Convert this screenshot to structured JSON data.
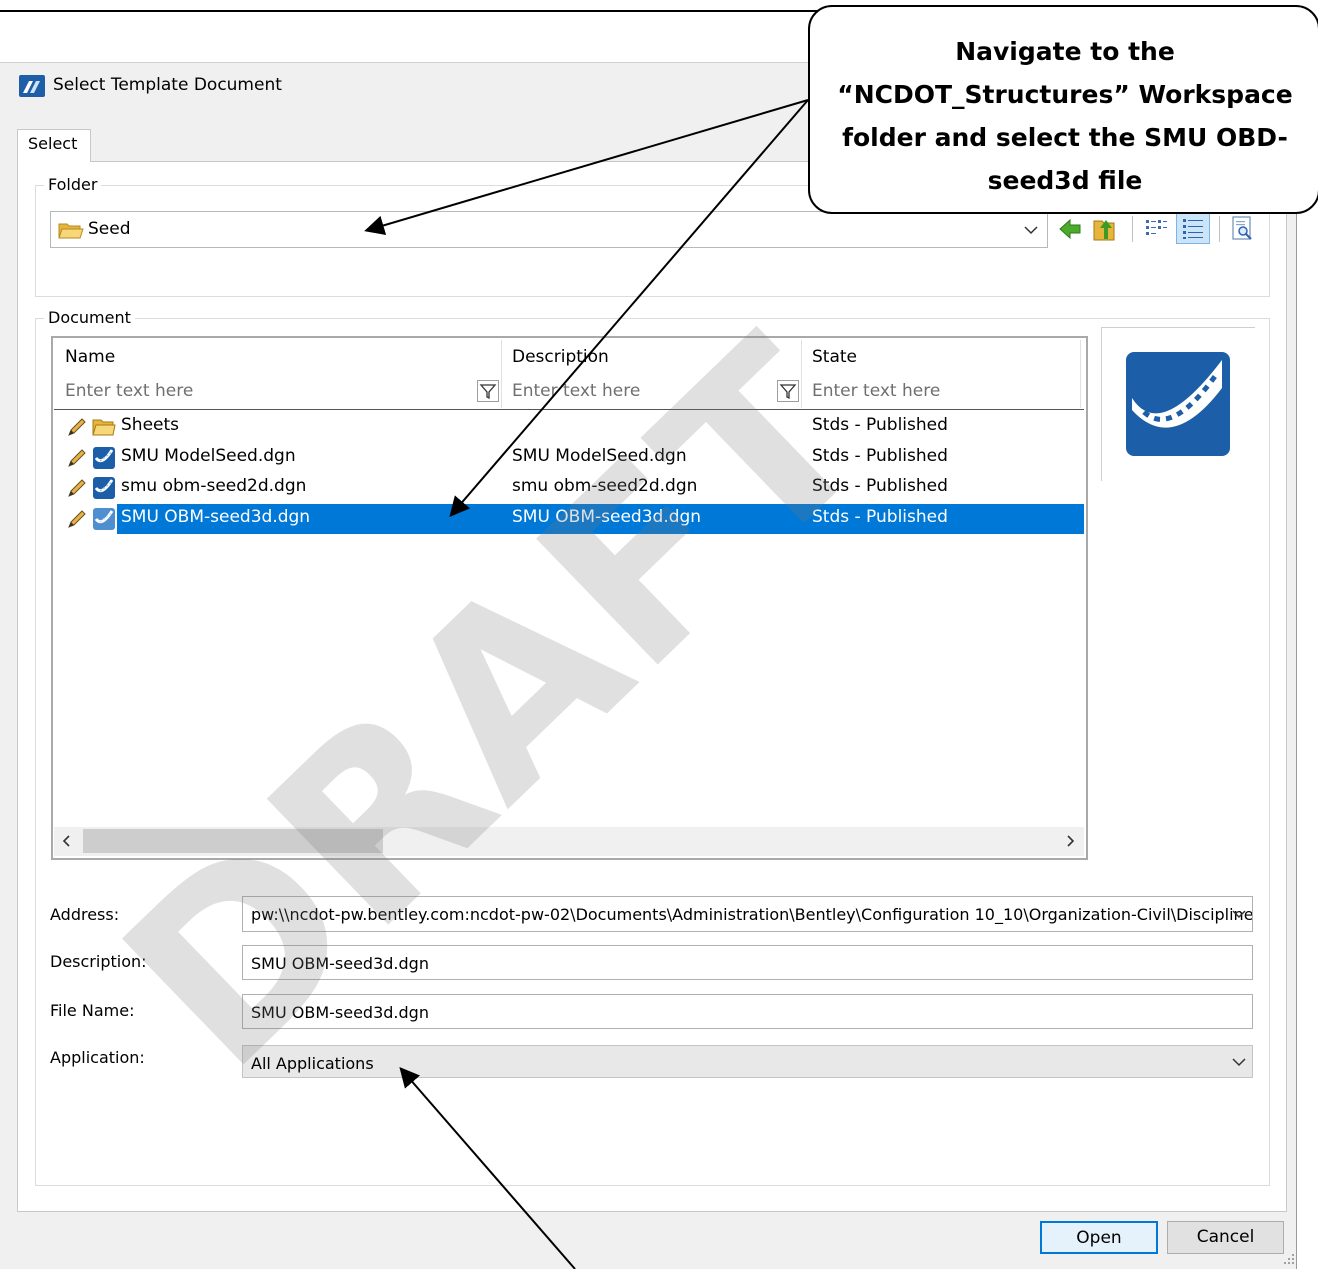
{
  "window": {
    "title": "Select Template Document"
  },
  "tabs": [
    {
      "label": "Select",
      "active": true
    }
  ],
  "folder": {
    "group_label": "Folder",
    "value": "Seed",
    "toolbar": [
      "back-icon",
      "folder-up-icon",
      "list-view-icon",
      "details-view-icon",
      "preview-icon"
    ]
  },
  "document": {
    "group_label": "Document",
    "columns": [
      {
        "name": "Name",
        "filter_placeholder": "Enter text here"
      },
      {
        "name": "Description",
        "filter_placeholder": "Enter text here"
      },
      {
        "name": "State",
        "filter_placeholder": "Enter text here"
      }
    ],
    "rows": [
      {
        "name": "Sheets",
        "description": "",
        "state": "Stds - Published",
        "type": "folder",
        "selected": false
      },
      {
        "name": "SMU ModelSeed.dgn",
        "description": "SMU ModelSeed.dgn",
        "state": "Stds - Published",
        "type": "dgn",
        "selected": false
      },
      {
        "name": "smu obm-seed2d.dgn",
        "description": "smu obm-seed2d.dgn",
        "state": "Stds - Published",
        "type": "dgn",
        "selected": false
      },
      {
        "name": "SMU OBM-seed3d.dgn",
        "description": "SMU OBM-seed3d.dgn",
        "state": "Stds - Published",
        "type": "dgn",
        "selected": true
      }
    ]
  },
  "fields": {
    "address": {
      "label": "Address:",
      "value": "pw:\\\\ncdot-pw.bentley.com:ncdot-pw-02\\Documents\\Administration\\Bentley\\Configuration 10_10\\Organization-Civil\\Discipline:"
    },
    "description": {
      "label": "Description:",
      "value": "SMU OBM-seed3d.dgn"
    },
    "file_name": {
      "label": "File Name:",
      "value": "SMU OBM-seed3d.dgn"
    },
    "application": {
      "label": "Application:",
      "value": "All Applications"
    }
  },
  "buttons": {
    "open": "Open",
    "cancel": "Cancel"
  },
  "watermark": "DRAFT",
  "callout": {
    "lines": [
      "Navigate to the",
      "“NCDOT_Structures” Workspace",
      "folder and select the SMU OBD-",
      "seed3d file"
    ]
  },
  "colors": {
    "selection": "#0078d7",
    "accent_folder": "#e8b73a",
    "dgn_icon": "#1c5fa8"
  }
}
